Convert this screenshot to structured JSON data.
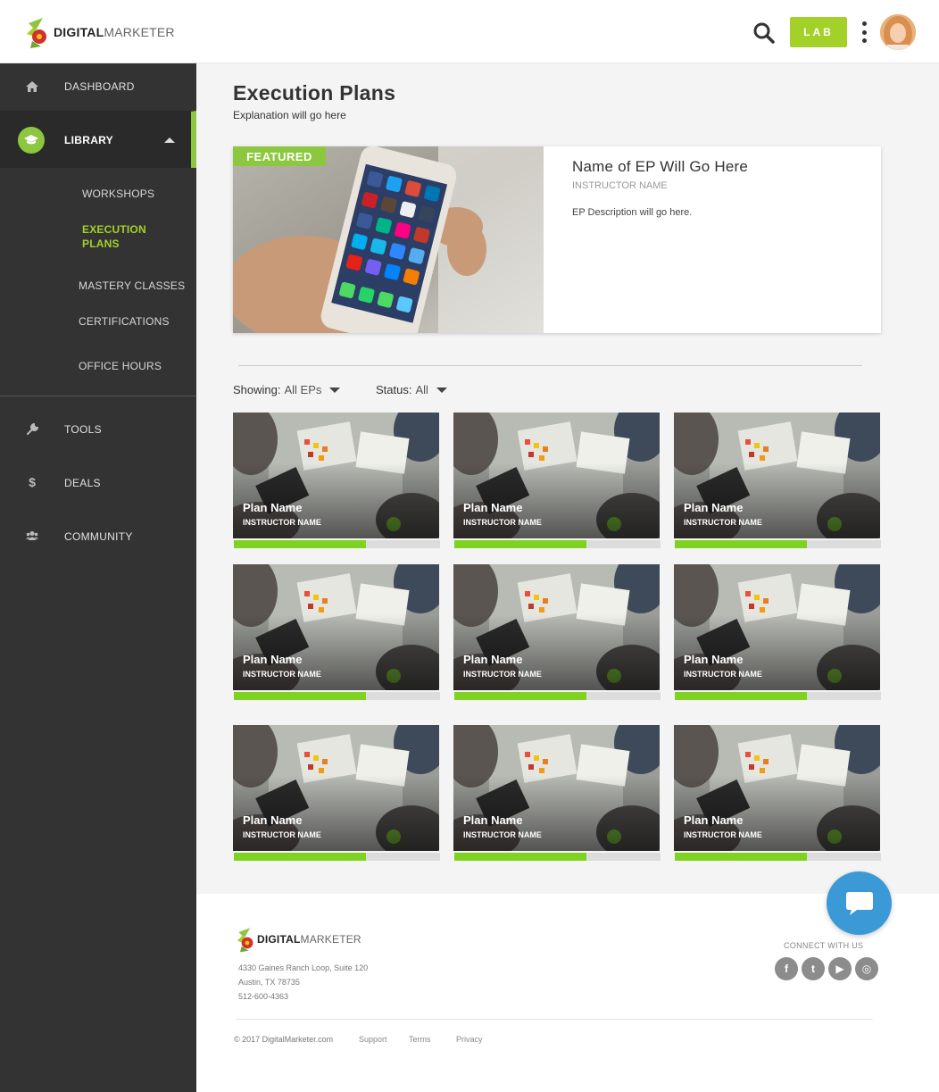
{
  "header": {
    "logo_bold": "DIGITAL",
    "logo_light": "MARKETER",
    "lab_label": "LAB"
  },
  "sidebar": {
    "dashboard": "DASHBOARD",
    "library": "LIBRARY",
    "library_sub": {
      "workshops": "WORKSHOPS",
      "execution_plans_1": "EXECUTION",
      "execution_plans_2": "PLANS",
      "mastery_classes": "MASTERY CLASSES",
      "certifications": "CERTIFICATIONS",
      "office_hours": "OFFICE HOURS"
    },
    "tools": "TOOLS",
    "deals": "DEALS",
    "community": "COMMUNITY"
  },
  "main": {
    "title": "Execution Plans",
    "subtitle": "Explanation will go here",
    "featured": {
      "badge": "FEATURED",
      "title": "Name of EP Will Go Here",
      "instructor": "INSTRUCTOR NAME",
      "description": "EP Description will go here."
    },
    "filters": {
      "showing_label": "Showing:",
      "showing_value": "All EPs",
      "status_label": "Status:",
      "status_value": "All"
    },
    "cards": [
      {
        "name": "Plan Name",
        "instructor": "INSTRUCTOR NAME",
        "progress": 0.64
      },
      {
        "name": "Plan Name",
        "instructor": "INSTRUCTOR NAME",
        "progress": 0.64
      },
      {
        "name": "Plan Name",
        "instructor": "INSTRUCTOR NAME",
        "progress": 0.64
      },
      {
        "name": "Plan Name",
        "instructor": "INSTRUCTOR NAME",
        "progress": 0.64
      },
      {
        "name": "Plan Name",
        "instructor": "INSTRUCTOR NAME",
        "progress": 0.64
      },
      {
        "name": "Plan Name",
        "instructor": "INSTRUCTOR NAME",
        "progress": 0.64
      },
      {
        "name": "Plan Name",
        "instructor": "INSTRUCTOR NAME",
        "progress": 0.64
      },
      {
        "name": "Plan Name",
        "instructor": "INSTRUCTOR NAME",
        "progress": 0.64
      },
      {
        "name": "Plan Name",
        "instructor": "INSTRUCTOR NAME",
        "progress": 0.64
      }
    ]
  },
  "footer": {
    "logo_bold": "DIGITAL",
    "logo_light": "MARKETER",
    "address_line1": "4330 Gaines Ranch Loop, Suite 120",
    "address_line2": "Austin, TX 78735",
    "phone": "512-600-4363",
    "connect": "CONNECT WITH US",
    "social": [
      {
        "icon": "facebook-icon",
        "glyph": "f"
      },
      {
        "icon": "twitter-icon",
        "glyph": "t"
      },
      {
        "icon": "youtube-icon",
        "glyph": "▶"
      },
      {
        "icon": "instagram-icon",
        "glyph": "◎"
      }
    ],
    "copyright": "© 2017 DigitalMarketer.com",
    "links": [
      "Support",
      "Terms",
      "Privacy"
    ]
  },
  "colors": {
    "accent_green": "#8dc63f",
    "lab_green": "#a3d12a",
    "progress_green": "#7ed321",
    "sidebar_bg": "#333333",
    "chat_blue": "#3b99d6"
  }
}
